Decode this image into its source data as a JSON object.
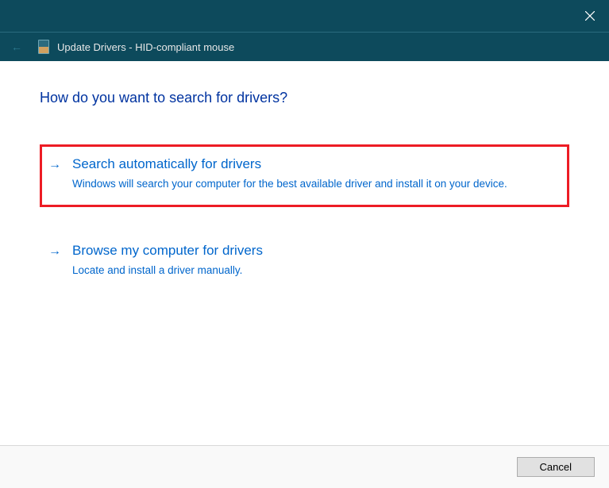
{
  "titlebar": {
    "close_icon": "close"
  },
  "header": {
    "title": "Update Drivers - HID-compliant mouse"
  },
  "content": {
    "heading": "How do you want to search for drivers?",
    "options": [
      {
        "title": "Search automatically for drivers",
        "description": "Windows will search your computer for the best available driver and install it on your device.",
        "highlighted": true
      },
      {
        "title": "Browse my computer for drivers",
        "description": "Locate and install a driver manually.",
        "highlighted": false
      }
    ]
  },
  "footer": {
    "cancel_label": "Cancel"
  }
}
